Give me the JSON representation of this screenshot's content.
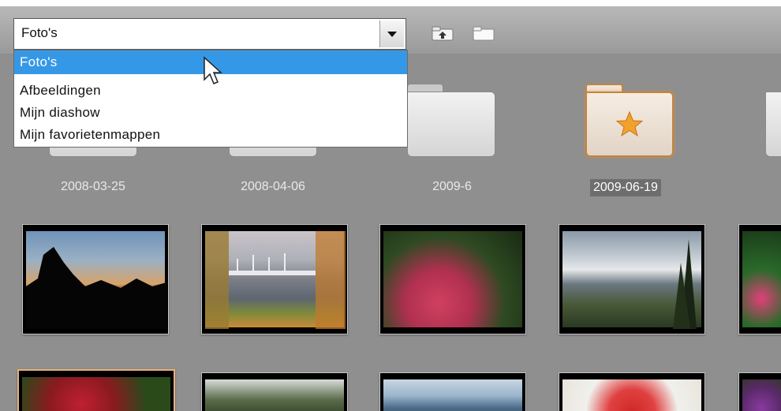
{
  "folder_combo": {
    "value": "Foto's",
    "options": [
      "Foto's",
      "Afbeeldingen",
      "Mijn diashow",
      "Mijn favorietenmappen"
    ],
    "highlighted_index": 0
  },
  "toolbar": {
    "up_icon": "folder-up-icon",
    "new_folder_icon": "folder-icon"
  },
  "folders": [
    {
      "label": "2008-03-25",
      "icon": "folder-icon"
    },
    {
      "label": "2008-04-06",
      "icon": "folder-icon"
    },
    {
      "label": "2009-6",
      "icon": "folder-icon"
    },
    {
      "label": "2009-06-19",
      "icon": "favorite-folder-icon",
      "selected": true
    }
  ],
  "thumbnails": [
    {
      "subject": "sunset-treeline"
    },
    {
      "subject": "marina-lake"
    },
    {
      "subject": "red-flower-garden"
    },
    {
      "subject": "mountain-valley"
    },
    {
      "subject": "pink-flowers"
    },
    {
      "subject": "red-foliage",
      "selected": true
    },
    {
      "subject": "forest-path"
    },
    {
      "subject": "lake-hills"
    },
    {
      "subject": "strawberries-plate"
    },
    {
      "subject": "purple-flowers"
    }
  ],
  "colors": {
    "background": "#8f8f8f",
    "selection": "#3598e6",
    "favorite_accent": "#c4843e",
    "star": "#f0a22a"
  }
}
